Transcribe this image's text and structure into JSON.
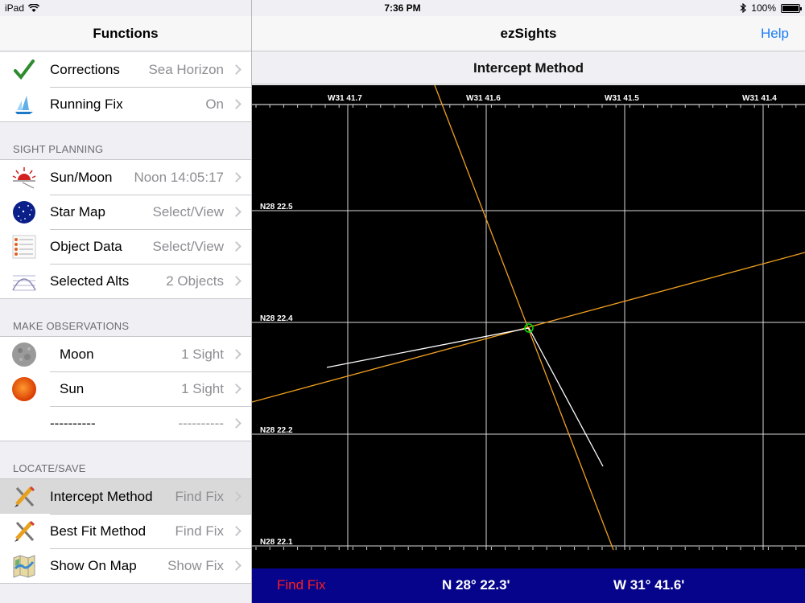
{
  "status_bar": {
    "device": "iPad",
    "time": "7:36 PM",
    "battery": "100%"
  },
  "left_panel": {
    "title": "Functions",
    "top_items": [
      {
        "label": "Corrections",
        "value": "Sea Horizon",
        "icon": "checkmark-icon"
      },
      {
        "label": "Running Fix",
        "value": "On",
        "icon": "running-fix-icon"
      }
    ],
    "sections": [
      {
        "header": "SIGHT PLANNING",
        "items": [
          {
            "label": "Sun/Moon",
            "value": "Noon 14:05:17",
            "icon": "sunrise-icon"
          },
          {
            "label": "Star Map",
            "value": "Select/View",
            "icon": "star-map-icon"
          },
          {
            "label": "Object Data",
            "value": "Select/View",
            "icon": "object-data-icon"
          },
          {
            "label": "Selected Alts",
            "value": "2 Objects",
            "icon": "altitude-curve-icon"
          }
        ]
      },
      {
        "header": "MAKE OBSERVATIONS",
        "items": [
          {
            "label": "Moon",
            "value": "1 Sight",
            "icon": "moon-icon"
          },
          {
            "label": "Sun",
            "value": "1 Sight",
            "icon": "sun-icon"
          },
          {
            "label": "----------",
            "value": "----------",
            "icon": ""
          }
        ]
      },
      {
        "header": "LOCATE/SAVE",
        "items": [
          {
            "label": "Intercept Method",
            "value": "Find Fix",
            "icon": "compass-pencil-icon"
          },
          {
            "label": "Best Fit Method",
            "value": "Find Fix",
            "icon": "compass-pencil-icon"
          },
          {
            "label": "Show On Map",
            "value": "Show Fix",
            "icon": "map-icon"
          }
        ]
      }
    ]
  },
  "right_panel": {
    "app_title": "ezSights",
    "help_label": "Help",
    "subtitle": "Intercept Method",
    "plot": {
      "lon_labels": [
        "W31 41.7",
        "W31 41.6",
        "W31 41.5",
        "W31 41.4"
      ],
      "lat_labels": [
        "N28 22.5",
        "N28 22.4",
        "N28 22.2",
        "N28 22.1"
      ],
      "line_of_position_color": "#f0a020",
      "azimuth_line_color": "#ffffff",
      "fix_marker_color": "#00e000"
    },
    "bottom_bar": {
      "find_fix_label": "Find Fix",
      "latitude": "N 28° 22.3'",
      "longitude": "W 31° 41.6'"
    }
  }
}
